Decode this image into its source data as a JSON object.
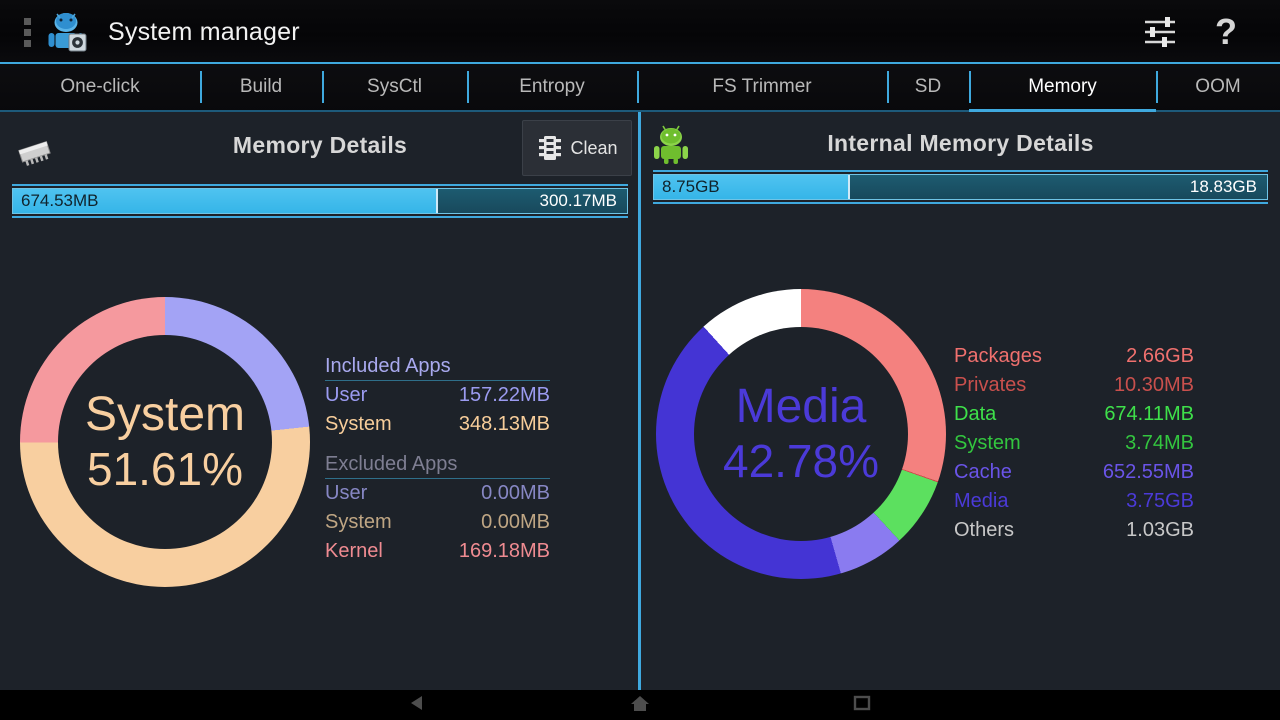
{
  "titlebar": {
    "title": "System manager",
    "menu_icon": "overflow-dots-icon",
    "app_icon": "android-settings-icon",
    "settings_icon": "sliders-icon",
    "help_icon": "question-mark-icon"
  },
  "tabs": [
    {
      "label": "One-click",
      "active": false
    },
    {
      "label": "Build",
      "active": false
    },
    {
      "label": "SysCtl",
      "active": false
    },
    {
      "label": "Entropy",
      "active": false
    },
    {
      "label": "FS Trimmer",
      "active": false
    },
    {
      "label": "SD",
      "active": false
    },
    {
      "label": "Memory",
      "active": true
    },
    {
      "label": "OOM",
      "active": false
    }
  ],
  "left_panel": {
    "icon": "ram-chip-icon",
    "title": "Memory Details",
    "clean_button": {
      "label": "Clean",
      "icon": "chip-icon"
    },
    "progress": {
      "used_label": "674.53MB",
      "free_label": "300.17MB",
      "fill_percent": 69.2
    },
    "donut_center_label": "System",
    "donut_center_percent": "51.61%",
    "included_header": "Included Apps",
    "included": [
      {
        "label": "User",
        "value": "157.22MB",
        "color": "#9b9bf0"
      },
      {
        "label": "System",
        "value": "348.13MB",
        "color": "#f7cd9a"
      }
    ],
    "excluded_header": "Excluded Apps",
    "excluded": [
      {
        "label": "User",
        "value": "0.00MB",
        "color": "#7f7fb8"
      },
      {
        "label": "System",
        "value": "0.00MB",
        "color": "#c9ab86"
      },
      {
        "label": "Kernel",
        "value": "169.18MB",
        "color": "#f08a90"
      }
    ]
  },
  "right_panel": {
    "icon": "android-robot-icon",
    "title": "Internal Memory Details",
    "progress": {
      "used_label": "8.75GB",
      "free_label": "18.83GB",
      "fill_percent": 32.0
    },
    "donut_center_label": "Media",
    "donut_center_percent": "42.78%",
    "legend": [
      {
        "label": "Packages",
        "value": "2.66GB",
        "color": "#f0706e"
      },
      {
        "label": "Privates",
        "value": "10.30MB",
        "color": "#c94f4c"
      },
      {
        "label": "Data",
        "value": "674.11MB",
        "color": "#3ee04a"
      },
      {
        "label": "System",
        "value": "3.74MB",
        "color": "#38cc44"
      },
      {
        "label": "Cache",
        "value": "652.55MB",
        "color": "#6a54e8"
      },
      {
        "label": "Media",
        "value": "3.75GB",
        "color": "#4b3ad8"
      },
      {
        "label": "Others",
        "value": "1.03GB",
        "color": "#c8c8c8"
      }
    ]
  },
  "navbar": {
    "back_icon": "back-triangle-icon",
    "home_icon": "home-icon",
    "recents_icon": "recents-icon"
  },
  "chart_data": [
    {
      "type": "pie",
      "title": "Memory Details",
      "center_label": "System",
      "center_value": "51.61%",
      "categories": [
        "Included User",
        "Included System",
        "Kernel"
      ],
      "values": [
        157.22,
        348.13,
        169.18
      ],
      "unit": "MB",
      "colors": [
        "#a3a3f5",
        "#f8cfa0",
        "#f5999e"
      ],
      "start_angle_deg": 0,
      "legend_position": "right",
      "total_used": 674.53,
      "total_free": 300.17
    },
    {
      "type": "pie",
      "title": "Internal Memory Details",
      "center_label": "Media",
      "center_value": "42.78%",
      "categories": [
        "Packages",
        "Privates",
        "Data",
        "System",
        "Cache",
        "Media",
        "Others"
      ],
      "values": [
        2660,
        10.3,
        674.11,
        3.74,
        652.55,
        3750,
        1030
      ],
      "unit": "MB",
      "colors": [
        "#f4817f",
        "#c94f4c",
        "#5ce05f",
        "#38cc44",
        "#8a7bf0",
        "#4434d4",
        "#ffffff"
      ],
      "start_angle_deg": 0,
      "legend_position": "right",
      "total_used_gb": 8.75,
      "total_free_gb": 18.83
    }
  ]
}
